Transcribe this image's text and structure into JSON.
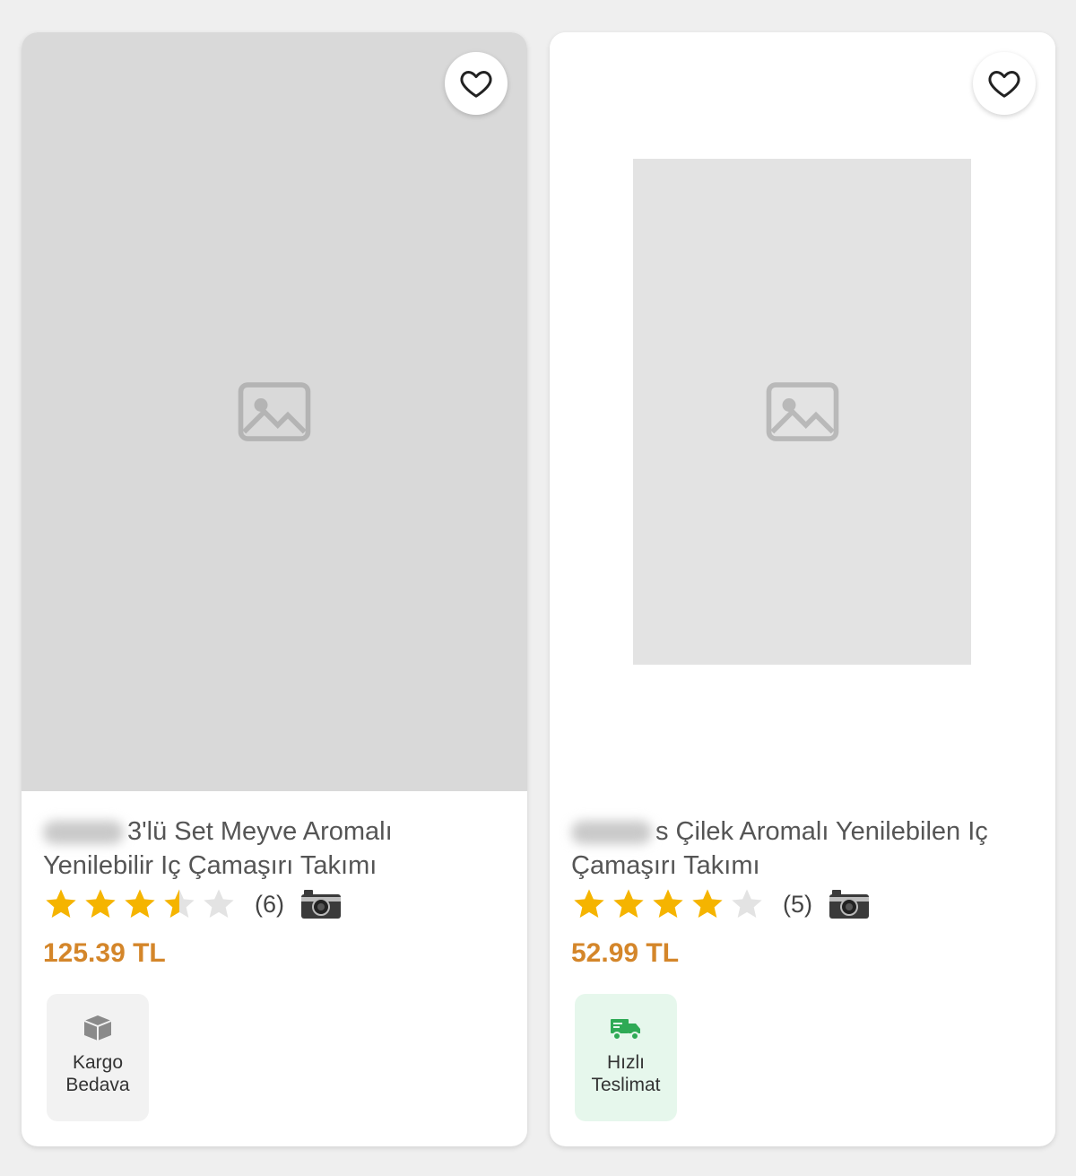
{
  "products": [
    {
      "title": "3'lü Set Meyve Aromalı Yenilebilir Iç Çamaşırı Takımı",
      "rating": 3.5,
      "rating_max": 5,
      "review_count": "(6)",
      "price": "125.39 TL",
      "badge": {
        "line1": "Kargo",
        "line2": "Bedava",
        "icon": "box-icon"
      }
    },
    {
      "title": "s Çilek Aromalı Yenilebilen Iç Çamaşırı Takımı",
      "rating": 4,
      "rating_max": 5,
      "review_count": "(5)",
      "price": "52.99 TL",
      "badge": {
        "line1": "Hızlı",
        "line2": "Teslimat",
        "icon": "truck-icon"
      }
    }
  ],
  "colors": {
    "price": "#d4862a",
    "star_filled": "#f5b400",
    "star_empty": "#e3e3e3",
    "badge_green": "#2eaa55",
    "badge_gray": "#8a8a8a"
  }
}
